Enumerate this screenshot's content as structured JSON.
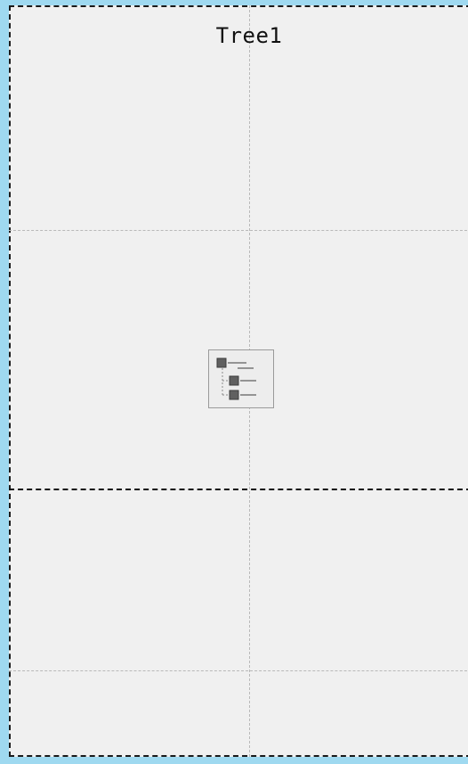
{
  "canvas": {
    "title": "Tree1",
    "widget": {
      "icon": "tree-view-icon",
      "type": "Tree"
    }
  },
  "colors": {
    "outer_background": "#9fd9f0",
    "canvas_background": "#f0f0f0",
    "grid_line": "#b9b9b9",
    "border_line": "#1a1a1a"
  }
}
